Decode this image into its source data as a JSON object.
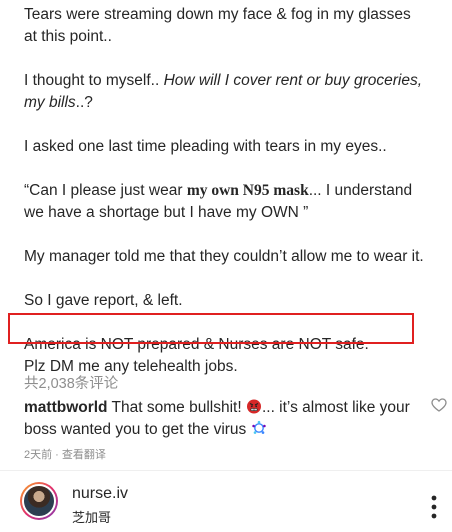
{
  "post": {
    "p1": "Tears were streaming down my face & fog in my glasses at this point..",
    "p2_a": "I thought to myself.. ",
    "p2_b": "How will I cover rent or buy groceries, my bills",
    "p2_c": "..?",
    "p3": "I asked one last time pleading with tears in my eyes..",
    "p4_a": "“Can I please just wear ",
    "p4_b": "my own N95 mask",
    "p4_c": "... I understand we have a shortage but I have my OWN ”",
    "p5": "My manager told me that they couldn’t allow me to wear it.",
    "p6": "So I gave report, & left.",
    "p7": "America is NOT prepared & Nurses are NOT safe.",
    "p8": "Plz DM me any telehealth jobs."
  },
  "comments": {
    "count_label": "共2,038条评论",
    "items": [
      {
        "user": "mattbworld",
        "text_a": " That some bullshit! ",
        "text_b": "... it’s almost like your boss wanted you to get the virus ",
        "meta": "2天前 · 查看翻译"
      }
    ]
  },
  "profile": {
    "username": "nurse.iv",
    "location": "芝加哥"
  },
  "icons": {
    "heart": "heart-outline-icon",
    "more": "more-vertical-icon",
    "angry_emoji": "angry-face-emoji",
    "virus_emoji": "virus-emoji"
  },
  "colors": {
    "highlight": "#e02020",
    "muted": "#8e8e8e",
    "text": "#262626"
  }
}
